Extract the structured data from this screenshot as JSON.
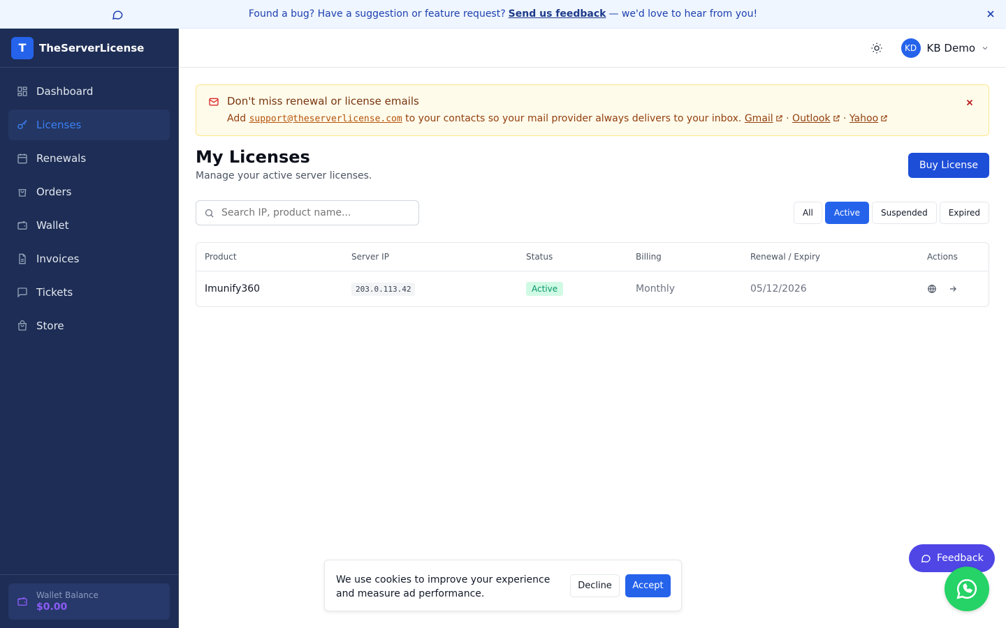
{
  "banner": {
    "text_before": "Found a bug? Have a suggestion or feature request?",
    "link": "Send us feedback",
    "text_after": "— we'd love to hear from you!",
    "icon": "chat-icon",
    "close_icon": "close-icon"
  },
  "sidebar": {
    "brand_letter": "T",
    "brand_name": "TheServerLicense",
    "items": [
      {
        "label": "Dashboard",
        "icon": "dashboard-icon"
      },
      {
        "label": "Licenses",
        "icon": "key-icon"
      },
      {
        "label": "Renewals",
        "icon": "calendar-icon"
      },
      {
        "label": "Orders",
        "icon": "bag-icon"
      },
      {
        "label": "Wallet",
        "icon": "wallet-icon"
      },
      {
        "label": "Invoices",
        "icon": "document-icon"
      },
      {
        "label": "Tickets",
        "icon": "chat-icon"
      },
      {
        "label": "Store",
        "icon": "store-icon"
      }
    ],
    "active_item": "Licenses",
    "wallet_label": "Wallet Balance",
    "wallet_value": "$0.00"
  },
  "header": {
    "avatar_initials": "KD",
    "user_name": "KB Demo",
    "theme_icon": "sun-icon"
  },
  "notice": {
    "title": "Don't miss renewal or license emails",
    "text_before": "Add",
    "email": "support@theserverlicense.com",
    "text_after": "to your contacts so your mail provider always delivers to your inbox.",
    "links": [
      "Gmail",
      "Outlook",
      "Yahoo"
    ],
    "separator": "·"
  },
  "page": {
    "title": "My Licenses",
    "subtitle": "Manage your active server licenses.",
    "buy_button": "Buy License"
  },
  "search": {
    "placeholder": "Search IP, product name...",
    "value": ""
  },
  "filters": {
    "options": [
      "All",
      "Active",
      "Suspended",
      "Expired"
    ],
    "selected": "Active"
  },
  "table": {
    "columns": [
      "Product",
      "Server IP",
      "Status",
      "Billing",
      "Renewal / Expiry",
      "Actions"
    ],
    "rows": [
      {
        "product": "Imunify360",
        "ip": "203.0.113.42",
        "status": "Active",
        "billing": "Monthly",
        "renewal": "05/12/2026",
        "actions": [
          "globe-icon",
          "arrow-right-icon"
        ]
      }
    ]
  },
  "cookie": {
    "text": "We use cookies to improve your experience and measure ad performance.",
    "decline": "Decline",
    "accept": "Accept"
  },
  "feedback_button": "Feedback",
  "colors": {
    "sidebar_bg": "#1e2d55",
    "accent": "#2563eb",
    "feedback": "#4f46e5",
    "whatsapp": "#25d366",
    "status_active": "#059669"
  }
}
